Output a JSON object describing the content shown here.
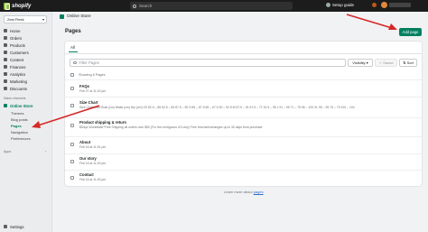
{
  "topbar": {
    "brand": "shopify",
    "search_placeholder": "Search",
    "setup_guide": "Setup guide"
  },
  "sidebar": {
    "store_name": "Zest Fleek",
    "items": [
      {
        "label": "Home",
        "icon": "home-icon"
      },
      {
        "label": "Orders",
        "icon": "orders-icon"
      },
      {
        "label": "Products",
        "icon": "products-icon"
      },
      {
        "label": "Customers",
        "icon": "customers-icon"
      },
      {
        "label": "Content",
        "icon": "content-icon"
      },
      {
        "label": "Finances",
        "icon": "finances-icon"
      },
      {
        "label": "Analytics",
        "icon": "analytics-icon"
      },
      {
        "label": "Marketing",
        "icon": "marketing-icon"
      },
      {
        "label": "Discounts",
        "icon": "discounts-icon"
      }
    ],
    "sales_channels_label": "Sales channels",
    "online_store": "Online Store",
    "sub_items": [
      "Themes",
      "Blog posts",
      "Pages",
      "Navigation",
      "Preferences"
    ],
    "apps_label": "Apps",
    "settings": "Settings"
  },
  "main": {
    "breadcrumb": "Online Store",
    "title": "Pages",
    "add_page": "Add page",
    "tab_all": "All",
    "filter_placeholder": "Filter Pages",
    "visibility": "Visibility",
    "saved": "Saved",
    "sort": "Sort",
    "showing": "Showing 6 Pages",
    "rows": [
      {
        "title": "FAQs",
        "sub": "Feb 27 at 11:20 pm"
      },
      {
        "title": "Size Chart",
        "sub": "Size Chart Size Bust (cm) Waist (cm) Hip (cm) XS 82.5 – 85 62.5 – 65 87.5 – 90 S 85 – 87.5 65 – 67.5 90 – 92.5 M 87.5 – 91 67.5 – 71 92.5 – 96 L 91 – 95 71 – 75 96 – 100 XL 95 – 99 75 – 79 100 – 104"
      },
      {
        "title": "Product shipping & return",
        "sub": "$Days Worldwide*Free Shipping all orders over $50 (For the contiguous US only) Free returns/exchanges up to 30 days from purchase"
      },
      {
        "title": "About",
        "sub": "Feb 16 at 11:01 pm"
      },
      {
        "title": "Our story",
        "sub": "Feb 16 at 11:00 pm"
      },
      {
        "title": "Contact",
        "sub": "Feb 16 at 11:00 pm"
      }
    ],
    "learn_prefix": "Learn more about ",
    "learn_link": "pages"
  },
  "colors": {
    "accent": "#008060",
    "arrow": "#d62828"
  }
}
